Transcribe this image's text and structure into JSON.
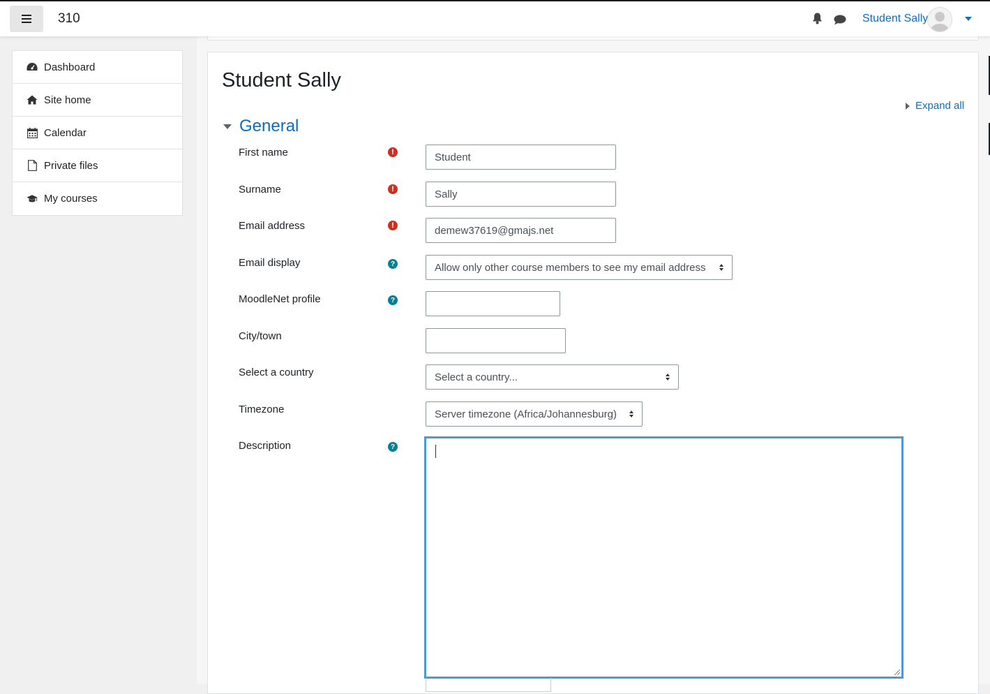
{
  "navbar": {
    "site_name": "310",
    "user_name": "Student Sally",
    "icons": [
      "menu-icon",
      "bell-icon",
      "chat-icon",
      "avatar",
      "chevron-down-icon"
    ]
  },
  "drawer": {
    "items": [
      {
        "label": "Dashboard",
        "icon": "dashboard-icon"
      },
      {
        "label": "Site home",
        "icon": "home-icon"
      },
      {
        "label": "Calendar",
        "icon": "calendar-icon"
      },
      {
        "label": "Private files",
        "icon": "file-icon"
      },
      {
        "label": "My courses",
        "icon": "graduation-cap-icon"
      }
    ]
  },
  "page": {
    "title": "Student Sally",
    "expand_all": "Expand all",
    "section_title": "General"
  },
  "form": {
    "first_name": {
      "label": "First name",
      "value": "Student"
    },
    "surname": {
      "label": "Surname",
      "value": "Sally"
    },
    "email": {
      "label": "Email address",
      "value": "demew37619@gmajs.net"
    },
    "email_display": {
      "label": "Email display",
      "value": "Allow only other course members to see my email address"
    },
    "moodlenet": {
      "label": "MoodleNet profile",
      "value": ""
    },
    "city": {
      "label": "City/town",
      "value": ""
    },
    "country": {
      "label": "Select a country",
      "value": "Select a country..."
    },
    "timezone": {
      "label": "Timezone",
      "value": "Server timezone (Africa/Johannesburg)"
    },
    "description": {
      "label": "Description",
      "value": ""
    }
  },
  "colors": {
    "link": "#0f6cbf",
    "required": "#ca3120",
    "help": "#008196",
    "focus": "#4a9ad8"
  }
}
